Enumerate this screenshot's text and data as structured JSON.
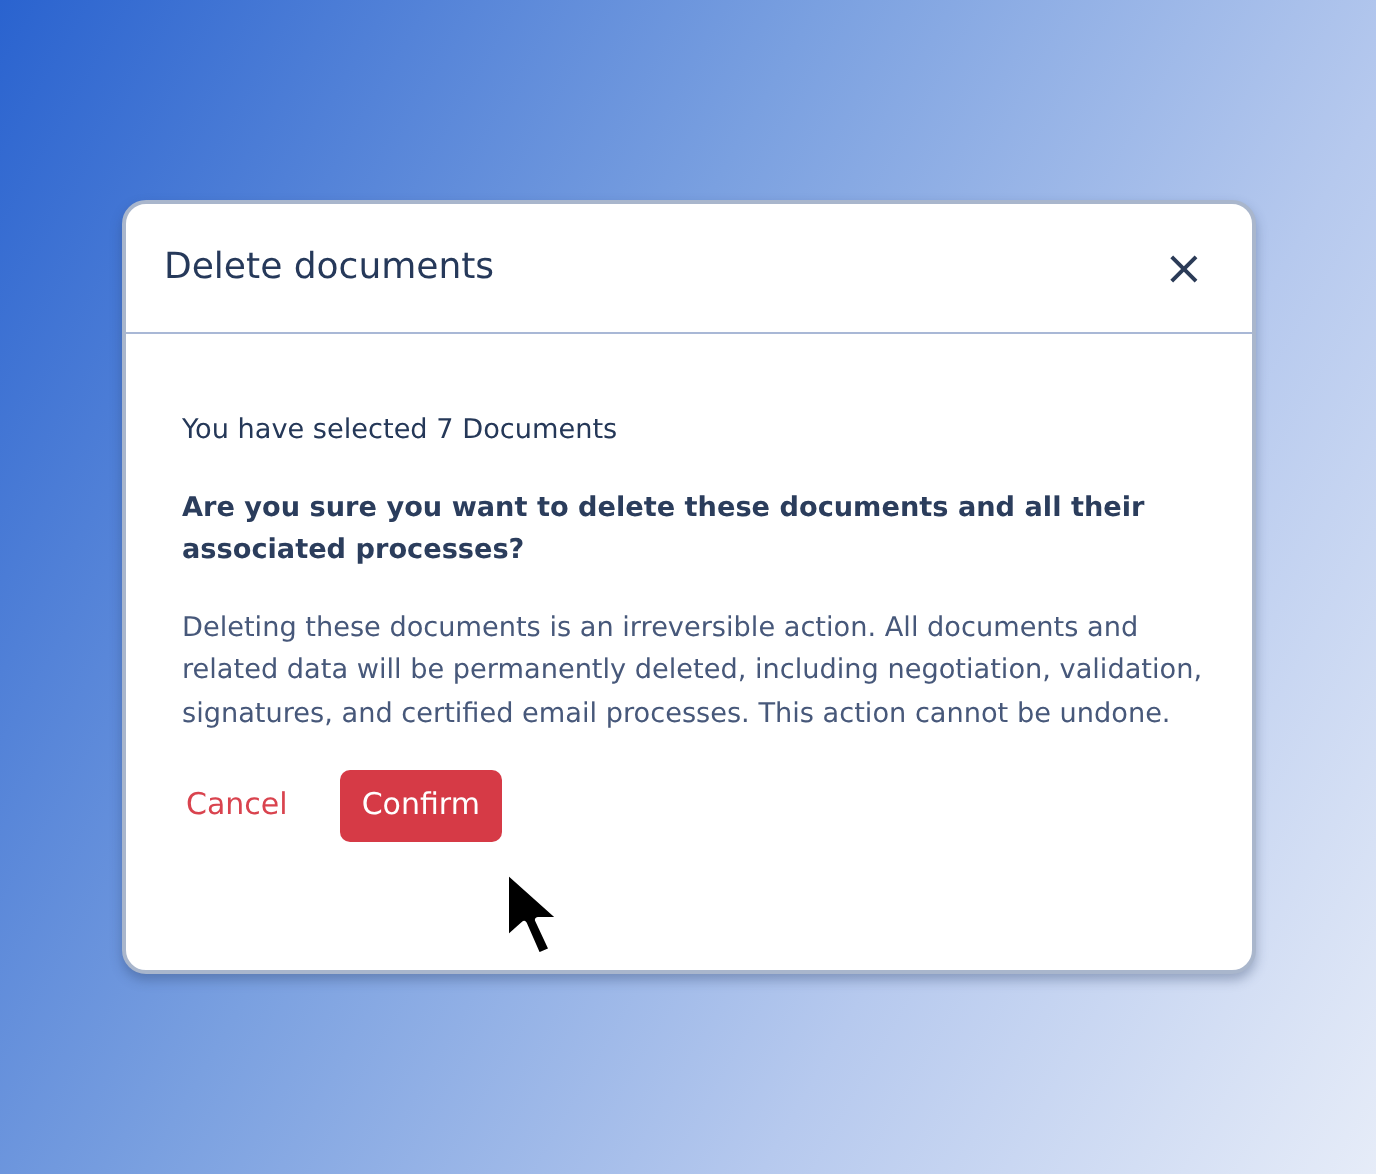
{
  "dialog": {
    "title": "Delete documents",
    "close": "×",
    "summary": "You have selected 7 Documents",
    "question": "Are you sure you want to delete these documents and all their associated processes?",
    "warning": "Deleting these documents is an irreversible action. All documents and related data will be permanently deleted, including negotiation, validation, signatures, and certified email processes. This action cannot be undone.",
    "buttons": [
      {
        "label": "Cancel",
        "kind": "link"
      },
      {
        "label": "Confirm",
        "kind": "danger"
      }
    ]
  }
}
